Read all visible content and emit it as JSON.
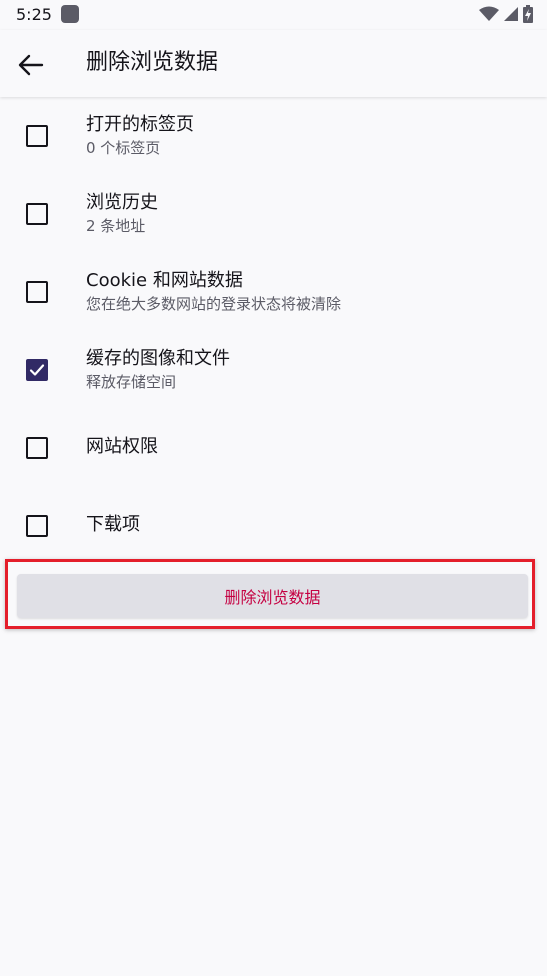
{
  "status_bar": {
    "time": "5:25",
    "icons": [
      "app-notification-icon",
      "wifi-icon",
      "signal-icon",
      "battery-charging-icon"
    ]
  },
  "app_bar": {
    "back_icon": "arrow-left-icon",
    "title": "删除浏览数据"
  },
  "options": [
    {
      "title": "打开的标签页",
      "subtitle": "0 个标签页",
      "checked": false
    },
    {
      "title": "浏览历史",
      "subtitle": "2 条地址",
      "checked": false
    },
    {
      "title": "Cookie 和网站数据",
      "subtitle": "您在绝大多数网站的登录状态将被清除",
      "checked": false
    },
    {
      "title": "缓存的图像和文件",
      "subtitle": "释放存储空间",
      "checked": true
    },
    {
      "title": "网站权限",
      "checked": false
    },
    {
      "title": "下载项",
      "checked": false
    }
  ],
  "delete_button": {
    "label": "删除浏览数据"
  },
  "colors": {
    "background": "#f9f9fb",
    "text_primary": "#15141a",
    "text_secondary": "#5b5b66",
    "checkbox_checked": "#312a65",
    "button_background": "#e0e0e6",
    "button_text": "#c50042",
    "highlight_border": "#e41e2b"
  }
}
